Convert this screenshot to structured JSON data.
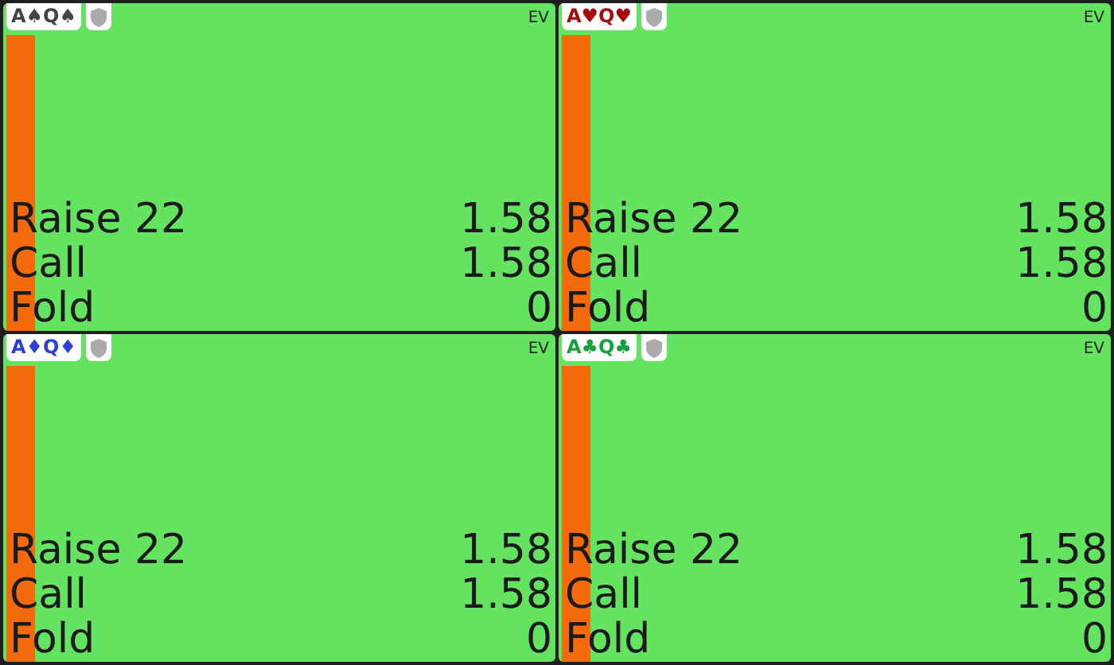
{
  "panels": [
    {
      "hand": "A♠Q♠",
      "color": "#444444",
      "metric": "EV",
      "actions": [
        {
          "name": "Raise 22",
          "value": "1.58"
        },
        {
          "name": "Call",
          "value": "1.58"
        },
        {
          "name": "Fold",
          "value": "0"
        }
      ]
    },
    {
      "hand": "A♥Q♥",
      "color": "#a30d0d",
      "metric": "EV",
      "actions": [
        {
          "name": "Raise 22",
          "value": "1.58"
        },
        {
          "name": "Call",
          "value": "1.58"
        },
        {
          "name": "Fold",
          "value": "0"
        }
      ]
    },
    {
      "hand": "A♦Q♦",
      "color": "#2b3fd6",
      "metric": "EV",
      "actions": [
        {
          "name": "Raise 22",
          "value": "1.58"
        },
        {
          "name": "Call",
          "value": "1.58"
        },
        {
          "name": "Fold",
          "value": "0"
        }
      ]
    },
    {
      "hand": "A♣Q♣",
      "color": "#14a03c",
      "metric": "EV",
      "actions": [
        {
          "name": "Raise 22",
          "value": "1.58"
        },
        {
          "name": "Call",
          "value": "1.58"
        },
        {
          "name": "Fold",
          "value": "0"
        }
      ]
    }
  ]
}
